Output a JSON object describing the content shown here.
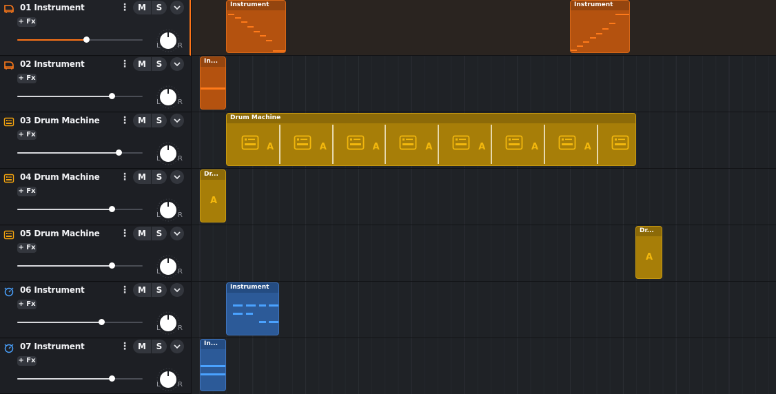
{
  "colors": {
    "accent_orange": "#ff7417",
    "clip_orange": "#b4520f",
    "clip_yellow": "#a77e08",
    "clip_blue": "#2c5a98",
    "drum_letter": "#f3b80d"
  },
  "tracks": [
    {
      "number": "01",
      "name": "Instrument",
      "icon": "piano-icon",
      "mute_label": "M",
      "solo_label": "S",
      "fx_label": "+ Fx",
      "volume": 0.55,
      "pan_left": "L",
      "pan_right": "R",
      "selected": true
    },
    {
      "number": "02",
      "name": "Instrument",
      "icon": "piano-icon",
      "mute_label": "M",
      "solo_label": "S",
      "fx_label": "+ Fx",
      "volume": 0.75,
      "pan_left": "L",
      "pan_right": "R"
    },
    {
      "number": "03",
      "name": "Drum Machine",
      "icon": "drum-machine-icon",
      "mute_label": "M",
      "solo_label": "S",
      "fx_label": "+ Fx",
      "volume": 0.81,
      "pan_left": "L",
      "pan_right": "R"
    },
    {
      "number": "04",
      "name": "Drum Machine",
      "icon": "drum-machine-icon",
      "mute_label": "M",
      "solo_label": "S",
      "fx_label": "+ Fx",
      "volume": 0.75,
      "pan_left": "L",
      "pan_right": "R"
    },
    {
      "number": "05",
      "name": "Drum Machine",
      "icon": "drum-machine-icon",
      "mute_label": "M",
      "solo_label": "S",
      "fx_label": "+ Fx",
      "volume": 0.75,
      "pan_left": "L",
      "pan_right": "R"
    },
    {
      "number": "06",
      "name": "Instrument",
      "icon": "synth-icon",
      "mute_label": "M",
      "solo_label": "S",
      "fx_label": "+ Fx",
      "volume": 0.67,
      "pan_left": "L",
      "pan_right": "R"
    },
    {
      "number": "07",
      "name": "Instrument",
      "icon": "synth-icon",
      "mute_label": "M",
      "solo_label": "S",
      "fx_label": "+ Fx",
      "volume": 0.75,
      "pan_left": "L",
      "pan_right": "R"
    }
  ],
  "clips": {
    "t1_a": {
      "title": "Instrument"
    },
    "t1_b": {
      "title": "Instrument"
    },
    "t2_a": {
      "title": "In..."
    },
    "t3_a": {
      "title": "Drum Machine",
      "pattern_label": "A"
    },
    "t4_a": {
      "title": "Dr...",
      "pattern_label": "A"
    },
    "t5_a": {
      "title": "Dr...",
      "pattern_label": "A"
    },
    "t6_a": {
      "title": "Instrument"
    },
    "t7_a": {
      "title": "In..."
    }
  }
}
